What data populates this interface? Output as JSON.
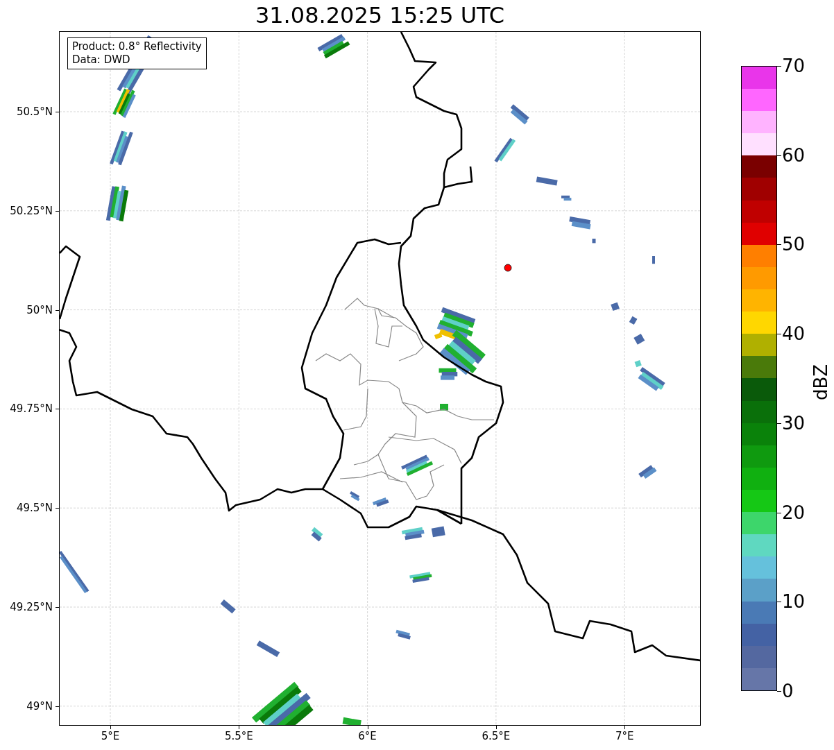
{
  "title": "31.08.2025 15:25 UTC",
  "info_box": {
    "lines": [
      "Product: 0.8° Reflectivity",
      "Data: DWD"
    ]
  },
  "map": {
    "y_ticks": [
      "50.5°N",
      "50.25°N",
      "50°N",
      "49.75°N",
      "49.5°N",
      "49.25°N",
      "49°N"
    ],
    "x_ticks": [
      "5°E",
      "5.5°E",
      "6°E",
      "6.5°E",
      "7°E"
    ]
  },
  "colorbar": {
    "label": "dBZ",
    "ticks": [
      "70",
      "60",
      "50",
      "40",
      "30",
      "20",
      "10",
      "0"
    ],
    "segments": [
      {
        "color": "#6676a8"
      },
      {
        "color": "#5468a0"
      },
      {
        "color": "#4462a4"
      },
      {
        "color": "#4a7ab5"
      },
      {
        "color": "#5ba0c8"
      },
      {
        "color": "#65c1dc"
      },
      {
        "color": "#5fd8c0"
      },
      {
        "color": "#3dd66b"
      },
      {
        "color": "#15c815"
      },
      {
        "color": "#10b010"
      },
      {
        "color": "#0f9a0f"
      },
      {
        "color": "#0a820a"
      },
      {
        "color": "#0a700a"
      },
      {
        "color": "#0a5a0a"
      },
      {
        "color": "#4a7a0a"
      },
      {
        "color": "#b0b000"
      },
      {
        "color": "#ffd700"
      },
      {
        "color": "#ffb400"
      },
      {
        "color": "#ff9a00"
      },
      {
        "color": "#ff7f00"
      },
      {
        "color": "#e00000"
      },
      {
        "color": "#c00000"
      },
      {
        "color": "#a00000"
      },
      {
        "color": "#7a0000"
      },
      {
        "color": "#ffe0ff"
      },
      {
        "color": "#ffb3ff"
      },
      {
        "color": "#ff66ff"
      },
      {
        "color": "#e935ea"
      }
    ]
  }
}
